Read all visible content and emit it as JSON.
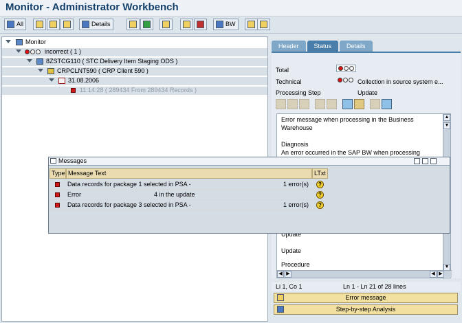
{
  "window": {
    "title": "Monitor - Administrator Workbench"
  },
  "toolbar": {
    "all_label": "All",
    "details_label": "Details",
    "bw_label": "BW"
  },
  "tree": {
    "root": "Monitor",
    "status": "incorrect ( 1 )",
    "ods": "8ZSTCG110 ( STC Delivery Item Staging ODS )",
    "client": "CRPCLNT590 ( CRP Client 590 )",
    "date": "31.08.2006",
    "request": "11:14:28 ( 289434 From 289434 Records )"
  },
  "tabs": [
    "Header",
    "Status",
    "Details"
  ],
  "status_panel": {
    "total_label": "Total",
    "technical_label": "Technical",
    "technical_value": "Collection in source system e...",
    "processing_step_label": "Processing Step",
    "processing_step_value": "Update"
  },
  "text_area": {
    "lines": [
      "Error message when processing in the Business",
      "Warehouse",
      "Diagnosis",
      "An error occurred in the SAP BW when processing",
      "Update",
      "Update",
      "Procedure"
    ]
  },
  "cursor_status": {
    "position": "Li 1, Co 1",
    "range": "Ln 1 - Ln 21 of 28 lines"
  },
  "buttons": {
    "error_message": "Error message",
    "step_by_step": "Step-by-step Analysis"
  },
  "messages_dialog": {
    "title": "Messages",
    "columns": [
      "Type",
      "Message Text",
      "LTxt"
    ],
    "rows": [
      {
        "text": "Data records for package 1 selected in PSA -",
        "detail": "1 error(s)"
      },
      {
        "text": "Error",
        "detail": "4 in the update"
      },
      {
        "text": "Data records for package 3 selected in PSA -",
        "detail": "1 error(s)"
      }
    ]
  }
}
